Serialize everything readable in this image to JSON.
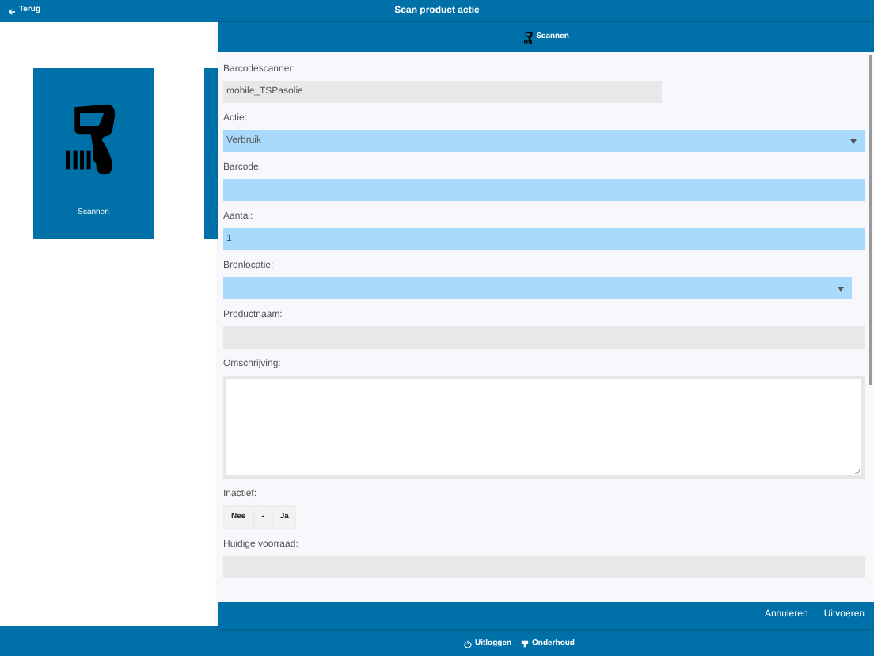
{
  "top_bar": {
    "back_label": "Terug",
    "title": "Scan product actie"
  },
  "tiles": [
    {
      "label": "Scannen"
    }
  ],
  "dialog": {
    "title": "Scannen",
    "fields": [
      {
        "kind": "readonly",
        "label": "Barcodescanner:",
        "value": "mobile_TSPasolie",
        "narrow": true
      },
      {
        "kind": "select",
        "label": "Actie:",
        "value": "Verbruik",
        "narrow": false
      },
      {
        "kind": "input",
        "label": "Barcode:",
        "narrow": false
      },
      {
        "kind": "input",
        "label": "Aantal:",
        "value": "1",
        "narrow": false
      },
      {
        "kind": "select",
        "label": "Bronlocatie:",
        "narrow": true
      },
      {
        "kind": "readonly",
        "label": "Productnaam:",
        "narrow": false
      },
      {
        "kind": "textarea",
        "label": "Omschrijving:"
      },
      {
        "kind": "toggle",
        "label": "Inactief:",
        "options": [
          {
            "label": "Nee",
            "selected": false
          },
          {
            "label": "-",
            "selected": false
          },
          {
            "label": "Ja",
            "selected": false
          }
        ]
      },
      {
        "kind": "readonly",
        "label": "Huidige voorraad:",
        "narrow": false
      }
    ],
    "footer_buttons": [
      "Annuleren",
      "Uitvoeren"
    ]
  },
  "bottom_bar": [
    {
      "kind": "logout",
      "label": "Uitloggen"
    },
    {
      "kind": "maintenance",
      "label": "Onderhoud"
    }
  ]
}
